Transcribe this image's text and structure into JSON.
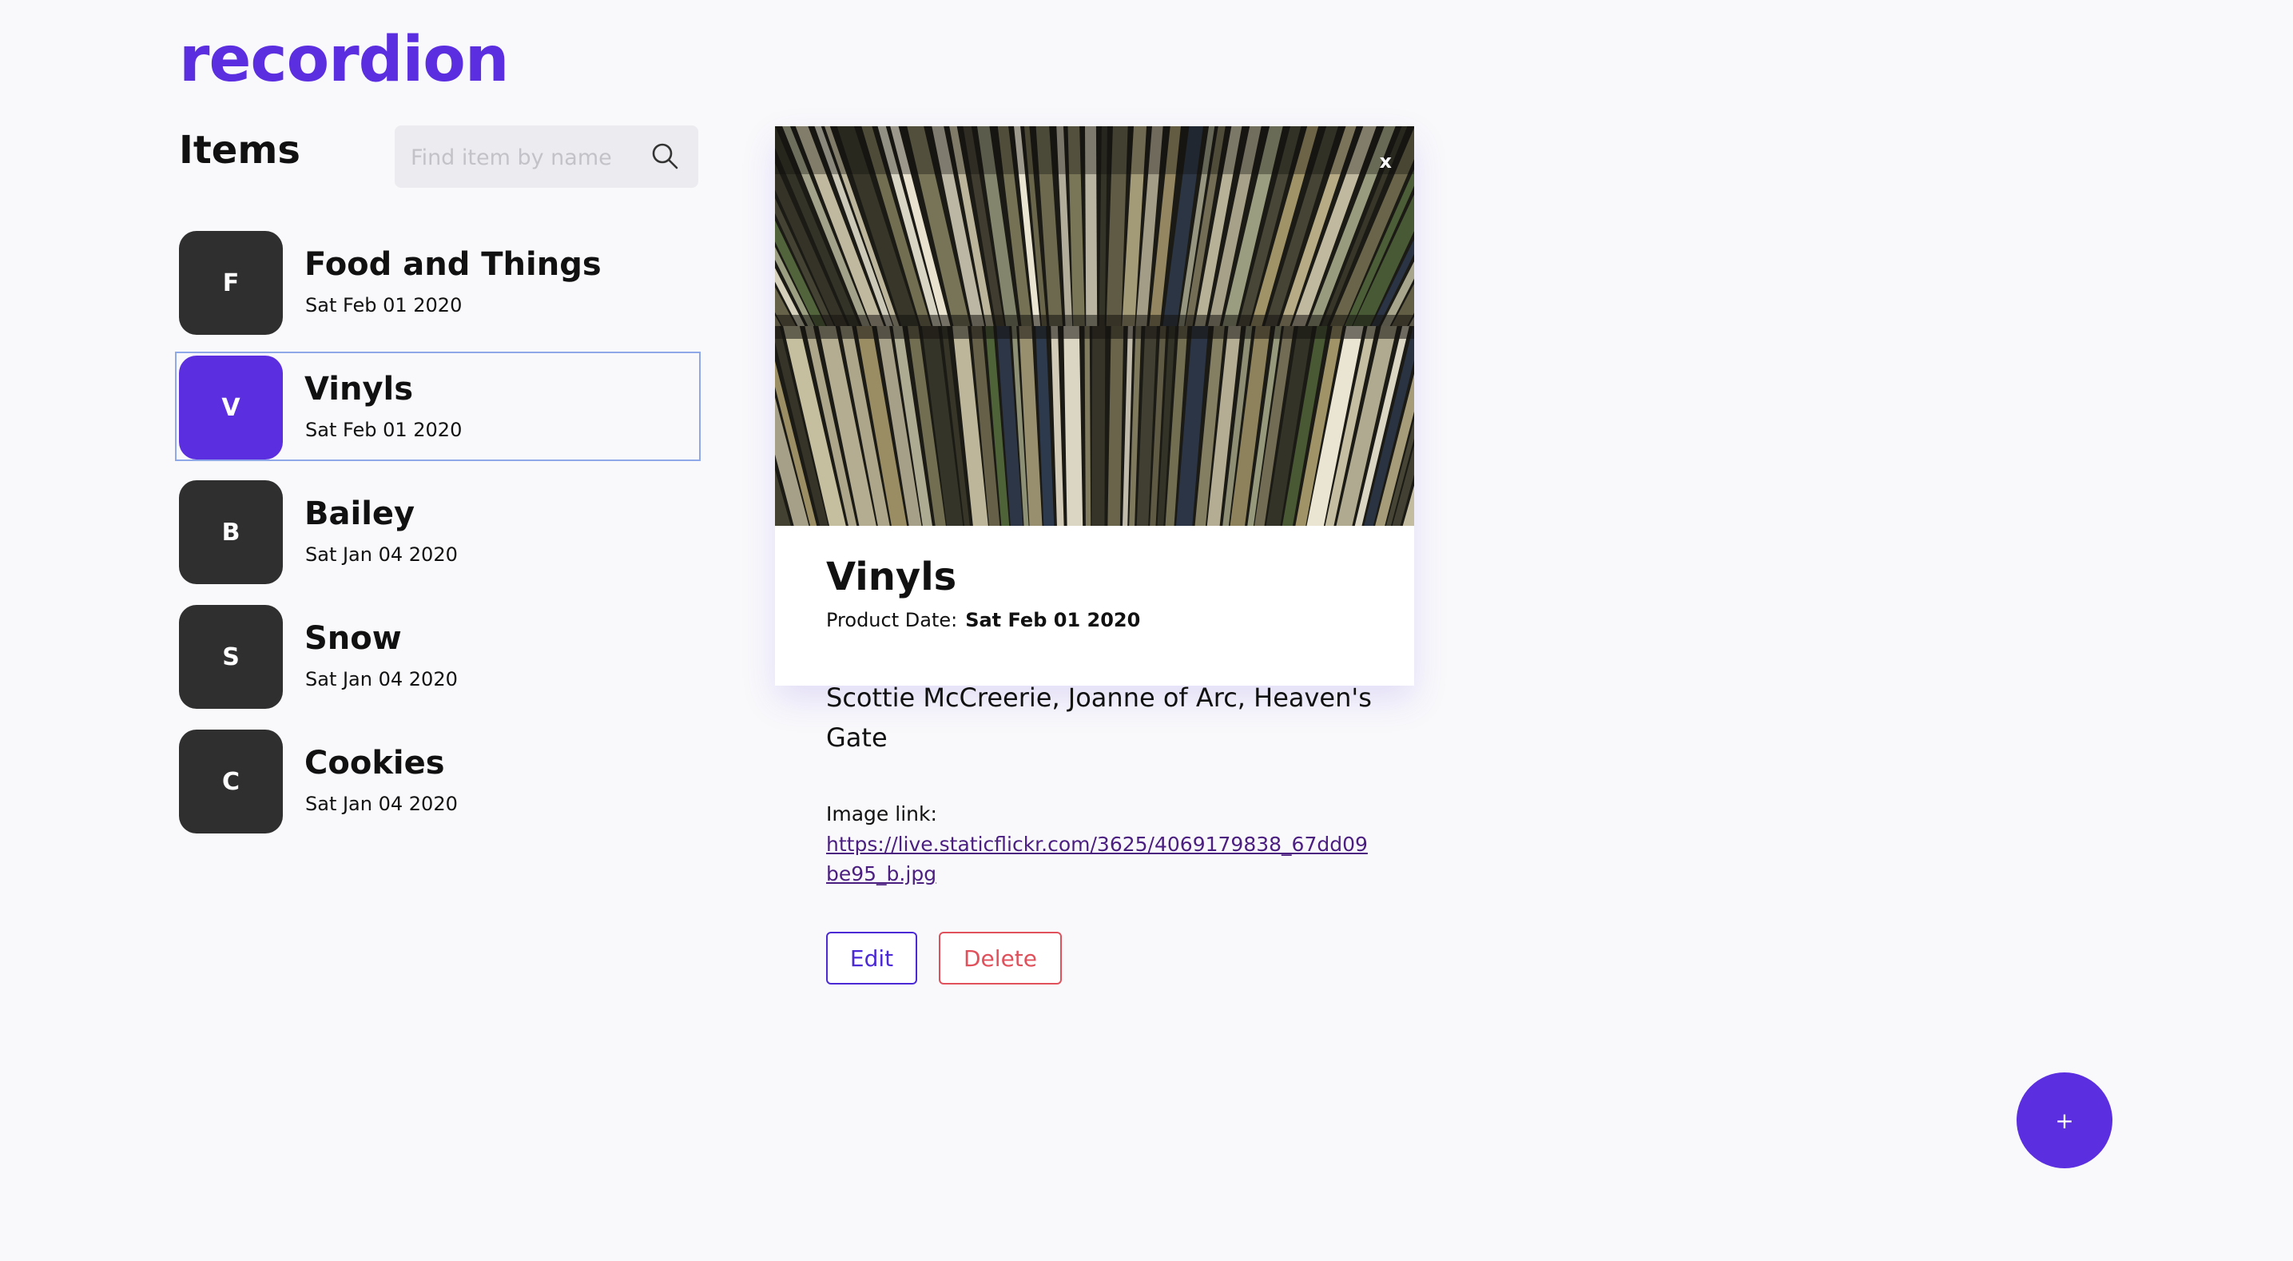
{
  "app": {
    "logo": "recordion"
  },
  "sidebar": {
    "title": "Items",
    "search": {
      "placeholder": "Find item by name",
      "value": ""
    },
    "items": [
      {
        "initial": "F",
        "name": "Food and Things",
        "date": "Sat Feb 01 2020",
        "selected": false
      },
      {
        "initial": "V",
        "name": "Vinyls",
        "date": "Sat Feb 01 2020",
        "selected": true
      },
      {
        "initial": "B",
        "name": "Bailey",
        "date": "Sat Jan 04 2020",
        "selected": false
      },
      {
        "initial": "S",
        "name": "Snow",
        "date": "Sat Jan 04 2020",
        "selected": false
      },
      {
        "initial": "C",
        "name": "Cookies",
        "date": "Sat Jan 04 2020",
        "selected": false
      }
    ]
  },
  "detail": {
    "close_label": "x",
    "title": "Vinyls",
    "date_label": "Product Date:",
    "date_value": "Sat Feb 01 2020",
    "description": "Scottie McCreerie, Joanne of Arc, Heaven's Gate",
    "image_link_label": "Image link:",
    "image_link": "https://live.staticflickr.com/3625/4069179838_67dd09be95_b.jpg",
    "edit_label": "Edit",
    "delete_label": "Delete"
  },
  "fab": {
    "label": "+"
  },
  "colors": {
    "accent": "#5b2ee0",
    "avatar_dark": "#2f2f30",
    "delete": "#e0515c",
    "background": "#f9f9fb"
  }
}
